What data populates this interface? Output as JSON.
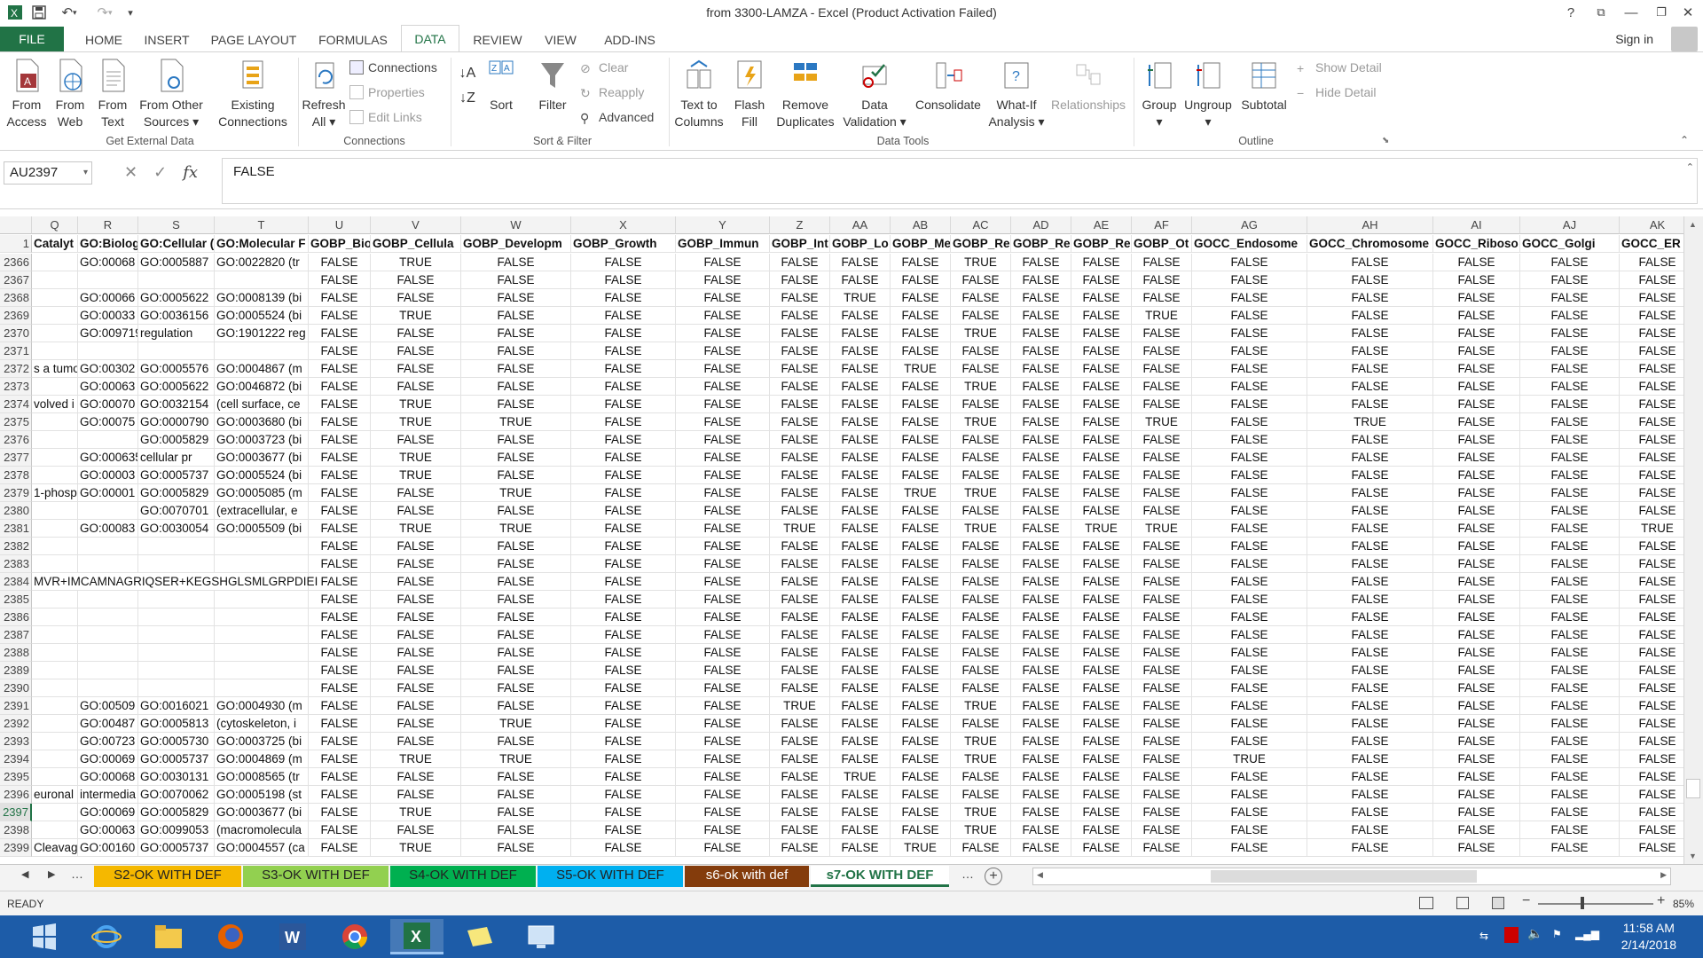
{
  "window": {
    "title": "from 3300-LAMZA - Excel (Product Activation Failed)"
  },
  "quick_access": [
    "excel-logo",
    "save",
    "undo",
    "redo",
    "customize"
  ],
  "ribbon_tabs": [
    "FILE",
    "HOME",
    "INSERT",
    "PAGE LAYOUT",
    "FORMULAS",
    "DATA",
    "REVIEW",
    "VIEW",
    "ADD-INS"
  ],
  "active_tab": "DATA",
  "sign_in": "Sign in",
  "ribbon": {
    "get_external": {
      "label": "Get External Data",
      "from_access": "From\nAccess",
      "from_web": "From\nWeb",
      "from_text": "From\nText",
      "from_other": "From Other\nSources ▾",
      "existing": "Existing\nConnections"
    },
    "connections": {
      "label": "Connections",
      "refresh": "Refresh\nAll ▾",
      "connections": "Connections",
      "properties": "Properties",
      "edit_links": "Edit Links"
    },
    "sort_filter": {
      "label": "Sort & Filter",
      "sort": "Sort",
      "filter": "Filter",
      "clear": "Clear",
      "reapply": "Reapply",
      "advanced": "Advanced"
    },
    "data_tools": {
      "label": "Data Tools",
      "text_to_columns": "Text to\nColumns",
      "flash_fill": "Flash\nFill",
      "remove_duplicates": "Remove\nDuplicates",
      "data_validation": "Data\nValidation ▾",
      "consolidate": "Consolidate",
      "what_if": "What-If\nAnalysis ▾",
      "relationships": "Relationships"
    },
    "outline": {
      "label": "Outline",
      "group": "Group\n▾",
      "ungroup": "Ungroup\n▾",
      "subtotal": "Subtotal",
      "show_detail": "Show Detail",
      "hide_detail": "Hide Detail"
    }
  },
  "formula_bar": {
    "name_box": "AU2397",
    "fx": "fx",
    "value": "FALSE"
  },
  "sheet": {
    "columns": [
      "Q",
      "R",
      "S",
      "T",
      "U",
      "V",
      "W",
      "X",
      "Y",
      "Z",
      "AA",
      "AB",
      "AC",
      "AD",
      "AE",
      "AF",
      "AG",
      "AH",
      "AI",
      "AJ",
      "AK"
    ],
    "header_row_num": "1",
    "headers": [
      "Catalyt",
      "GO:Biolog",
      "GO:Cellular (",
      "GO:Molecular F",
      "GOBP_Bio",
      "GOBP_Cellula",
      "GOBP_Developm",
      "GOBP_Growth",
      "GOBP_Immun",
      "GOBP_Int",
      "GOBP_Lo",
      "GOBP_Me",
      "GOBP_Re",
      "GOBP_Re",
      "GOBP_Re",
      "GOBP_Ot",
      "GOCC_Endosome",
      "GOCC_Chromosome",
      "GOCC_Riboso",
      "GOCC_Golgi",
      "GOCC_ER"
    ],
    "selected_row": "2397",
    "rows": [
      {
        "n": "2366",
        "t": [
          "",
          "GO:00068",
          "GO:0005887",
          "GO:0022820 (tr"
        ],
        "b": "FTFFFFFFTFFFFFFFF"
      },
      {
        "n": "2367",
        "t": [
          "",
          "",
          "",
          ""
        ],
        "b": "FFFFFFFFFFFFFFFFF"
      },
      {
        "n": "2368",
        "t": [
          "",
          "GO:00066",
          "GO:0005622",
          "GO:0008139 (bi"
        ],
        "b": "FFFFFFTFFFFFFFFFF"
      },
      {
        "n": "2369",
        "t": [
          "",
          "GO:00033",
          "GO:0036156",
          "GO:0005524 (bi"
        ],
        "b": "FTFFFFFFFFFTFFFFF"
      },
      {
        "n": "2370",
        "t": [
          "",
          "GO:0097190",
          "regulation",
          "GO:1901222 reg"
        ],
        "b": "FFFFFFFFTFFFFFFFF"
      },
      {
        "n": "2371",
        "t": [
          "",
          "",
          "",
          ""
        ],
        "b": "FFFFFFFFFFFFFFFFF"
      },
      {
        "n": "2372",
        "t": [
          "s a tumo",
          "GO:00302",
          "GO:0005576",
          "GO:0004867 (m"
        ],
        "b": "FFFFFFFTFFFFFFFFF"
      },
      {
        "n": "2373",
        "t": [
          "",
          "GO:00063",
          "GO:0005622",
          "GO:0046872 (bi"
        ],
        "b": "FFFFFFFFTFFFFFFFF"
      },
      {
        "n": "2374",
        "t": [
          "volved i",
          "GO:00070",
          "GO:0032154",
          "(cell surface, ce"
        ],
        "b": "FTFFFFFFFFFFFFFFF"
      },
      {
        "n": "2375",
        "t": [
          "",
          "GO:00075",
          "GO:0000790",
          "GO:0003680 (bi"
        ],
        "b": "FTTFFFFFTFFTFTFFF"
      },
      {
        "n": "2376",
        "t": [
          "",
          "",
          "GO:0005829",
          "GO:0003723 (bi"
        ],
        "b": "FFFFFFFFFFFFFFFFF"
      },
      {
        "n": "2377",
        "t": [
          "",
          "GO:0006352",
          "cellular pr",
          "GO:0003677 (bi"
        ],
        "b": "FTFFFFFFFFFFFFFFF"
      },
      {
        "n": "2378",
        "t": [
          "",
          "GO:00003",
          "GO:0005737",
          "GO:0005524 (bi"
        ],
        "b": "FTFFFFFFFFFFFFFFF"
      },
      {
        "n": "2379",
        "t": [
          "1-phosp",
          "GO:00001",
          "GO:0005829",
          "GO:0005085 (m"
        ],
        "b": "FFTFFFFTTFFFFFFFF"
      },
      {
        "n": "2380",
        "t": [
          "",
          "",
          "GO:0070701",
          "(extracellular, e"
        ],
        "b": "FFFFFFFFFFFFFFFFF"
      },
      {
        "n": "2381",
        "t": [
          "",
          "GO:00083",
          "GO:0030054",
          "GO:0005509 (bi"
        ],
        "b": "FTTFFTFFTFTTFFFFT"
      },
      {
        "n": "2382",
        "t": [
          "",
          "",
          "",
          ""
        ],
        "b": "FFFFFFFFFFFFFFFFF"
      },
      {
        "n": "2383",
        "t": [
          "",
          "",
          "",
          ""
        ],
        "b": "FFFFFFFFFFFFFFFFF"
      },
      {
        "n": "2384",
        "t": [
          "MVR+IMCAMNAGRIQSER+KEGSHGLSMLGRPDIEI",
          "",
          "",
          ""
        ],
        "b": "FFFFFFFFFFFFFFFFF"
      },
      {
        "n": "2385",
        "t": [
          "",
          "",
          "",
          ""
        ],
        "b": "FFFFFFFFFFFFFFFFF"
      },
      {
        "n": "2386",
        "t": [
          "",
          "",
          "",
          ""
        ],
        "b": "FFFFFFFFFFFFFFFFF"
      },
      {
        "n": "2387",
        "t": [
          "",
          "",
          "",
          ""
        ],
        "b": "FFFFFFFFFFFFFFFFF"
      },
      {
        "n": "2388",
        "t": [
          "",
          "",
          "",
          ""
        ],
        "b": "FFFFFFFFFFFFFFFFF"
      },
      {
        "n": "2389",
        "t": [
          "",
          "",
          "",
          ""
        ],
        "b": "FFFFFFFFFFFFFFFFF"
      },
      {
        "n": "2390",
        "t": [
          "",
          "",
          "",
          ""
        ],
        "b": "FFFFFFFFFFFFFFFFF"
      },
      {
        "n": "2391",
        "t": [
          "",
          "GO:00509",
          "GO:0016021",
          "GO:0004930 (m"
        ],
        "b": "FFFFFTFFTFFFFFFFF"
      },
      {
        "n": "2392",
        "t": [
          "",
          "GO:00487",
          "GO:0005813",
          "(cytoskeleton, i"
        ],
        "b": "FFTFFFFFFFFFFFFFF"
      },
      {
        "n": "2393",
        "t": [
          "",
          "GO:00723",
          "GO:0005730",
          "GO:0003725 (bi"
        ],
        "b": "FFFFFFFFTFFFFFFFF"
      },
      {
        "n": "2394",
        "t": [
          "",
          "GO:00069",
          "GO:0005737",
          "GO:0004869 (m"
        ],
        "b": "FTTFFFFFTFFFTFFFF"
      },
      {
        "n": "2395",
        "t": [
          "",
          "GO:00068",
          "GO:0030131",
          "GO:0008565 (tr"
        ],
        "b": "FFFFFFTFFFFFFFFFF"
      },
      {
        "n": "2396",
        "t": [
          "euronal",
          "intermedia",
          "GO:0070062",
          "GO:0005198 (st"
        ],
        "b": "FFFFFFFFFFFFFFFFF"
      },
      {
        "n": "2397",
        "t": [
          "",
          "GO:00069",
          "GO:0005829",
          "GO:0003677 (bi"
        ],
        "b": "FTFFFFFFTFFFFFFFF"
      },
      {
        "n": "2398",
        "t": [
          "",
          "GO:00063",
          "GO:0099053",
          "(macromolecula"
        ],
        "b": "FFFFFFFFTFFFFFFFF"
      },
      {
        "n": "2399",
        "t": [
          "Cleavag",
          "GO:00160",
          "GO:0005737",
          "GO:0004557 (ca"
        ],
        "b": "FTFFFFFTFFFFFFFFF"
      }
    ]
  },
  "bool_labels": {
    "T": "TRUE",
    "F": "FALSE"
  },
  "sheet_tabs": [
    {
      "label": "S2-OK WITH DEF",
      "color": "#f5b800"
    },
    {
      "label": "S3-OK WITH DEF",
      "color": "#92d050"
    },
    {
      "label": "S4-OK WITH DEF",
      "color": "#00b050"
    },
    {
      "label": "S5-OK WITH DEF",
      "color": "#00b0f0"
    },
    {
      "label": "s6-ok with def",
      "color": "#843c0c"
    },
    {
      "label": "s7-OK WITH DEF",
      "color": "#ffffff",
      "active": true
    }
  ],
  "status": {
    "ready": "READY",
    "zoom": "85%"
  },
  "clock": {
    "time": "11:58 AM",
    "date": "2/14/2018"
  },
  "colors": {
    "excel_green": "#217346",
    "taskbar": "#1d5ca8"
  }
}
